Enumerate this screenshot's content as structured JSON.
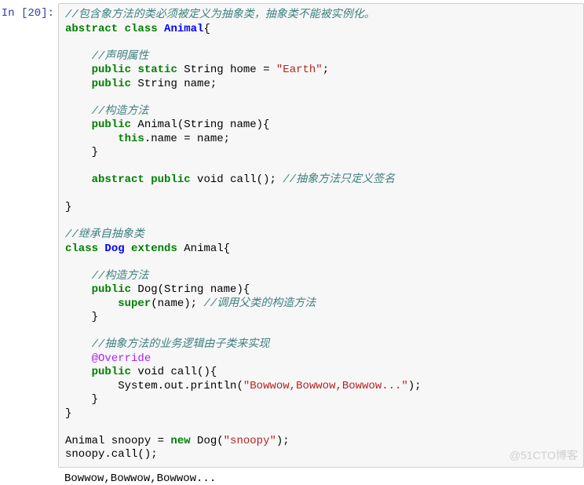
{
  "prompt": "In [20]:",
  "code": {
    "l1": {
      "c": "//包含象方法的类必须被定义为抽象类，抽象类不能被实例化。"
    },
    "l2": {
      "k1": "abstract",
      "sp": " ",
      "k2": "class",
      "sp2": " ",
      "nc": "Animal",
      "t": "{"
    },
    "l3": {
      "t": ""
    },
    "l4": {
      "pad": "    ",
      "c": "//声明属性"
    },
    "l5": {
      "pad": "    ",
      "k1": "public",
      "sp": " ",
      "k2": "static",
      "t": " String home = ",
      "s": "\"Earth\"",
      "t2": ";"
    },
    "l6": {
      "pad": "    ",
      "k": "public",
      "t": " String name;"
    },
    "l7": {
      "t": ""
    },
    "l8": {
      "pad": "    ",
      "c": "//构造方法"
    },
    "l9": {
      "pad": "    ",
      "k": "public",
      "t": " Animal(String name){"
    },
    "l10": {
      "pad": "        ",
      "k": "this",
      "t": ".name = name;"
    },
    "l11": {
      "pad": "    ",
      "t": "}"
    },
    "l12": {
      "t": ""
    },
    "l13": {
      "pad": "    ",
      "k1": "abstract",
      "sp": " ",
      "k2": "public",
      "t": " void call(); ",
      "c": "//抽象方法只定义签名"
    },
    "l14": {
      "t": ""
    },
    "l15": {
      "t": "}"
    },
    "l16": {
      "t": ""
    },
    "l17": {
      "c": "//继承自抽象类"
    },
    "l18": {
      "k1": "class",
      "sp": " ",
      "nc": "Dog",
      "sp2": " ",
      "k2": "extends",
      "t": " Animal{"
    },
    "l19": {
      "t": ""
    },
    "l20": {
      "pad": "    ",
      "c": "//构造方法"
    },
    "l21": {
      "pad": "    ",
      "k": "public",
      "t": " Dog(String name){"
    },
    "l22": {
      "pad": "        ",
      "k": "super",
      "t": "(name); ",
      "c": "//调用父类的构造方法"
    },
    "l23": {
      "pad": "    ",
      "t": "}"
    },
    "l24": {
      "t": ""
    },
    "l25": {
      "pad": "    ",
      "c": "//抽象方法的业务逻辑由子类来实现"
    },
    "l26": {
      "pad": "    ",
      "nd": "@Override"
    },
    "l27": {
      "pad": "    ",
      "k": "public",
      "t": " void call(){"
    },
    "l28": {
      "pad": "        ",
      "t": "System.out.println(",
      "s": "\"Bowwow,Bowwow,Bowwow...\"",
      "t2": ");"
    },
    "l29": {
      "pad": "    ",
      "t": "}"
    },
    "l30": {
      "t": "}"
    },
    "l31": {
      "t": ""
    },
    "l32": {
      "t": "Animal snoopy = ",
      "k": "new",
      "t2": " Dog(",
      "s": "\"snoopy\"",
      "t3": ");"
    },
    "l33": {
      "t": "snoopy.call();"
    }
  },
  "output": "Bowwow,Bowwow,Bowwow...",
  "watermark": "@51CTO博客"
}
